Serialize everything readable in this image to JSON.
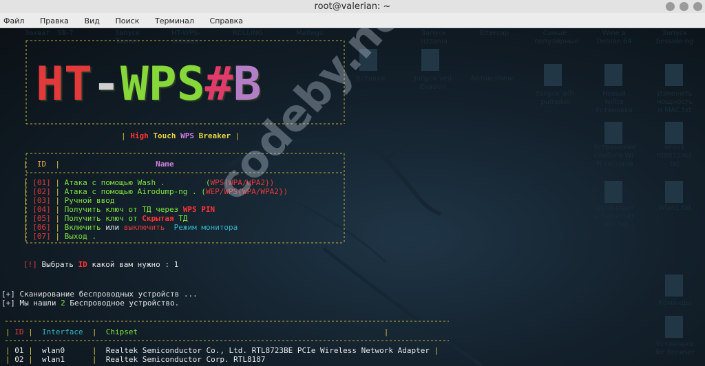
{
  "window": {
    "title": "root@valerian: ~"
  },
  "menu": [
    "Файл",
    "Правка",
    "Вид",
    "Поиск",
    "Терминал",
    "Справка"
  ],
  "banner": {
    "logo_text": "HT-WPS#B",
    "subtitle_pre": "|",
    "subtitle_high": "High",
    "subtitle_touch": "Touch",
    "subtitle_wps": "WPS",
    "subtitle_breaker": "Breaker",
    "subtitle_post": "|"
  },
  "menu_table": {
    "header_id": "ID",
    "header_name": "Name",
    "rows": [
      {
        "id": "[01]",
        "text": "Атака с помощью Wash .         (",
        "tag": "WPS{WPA/WPA2})"
      },
      {
        "id": "[02]",
        "text": "Атака с помощью Airodump-ng . (",
        "tag": "WEP/WPS{WPA/WPA2})"
      },
      {
        "id": "[03]",
        "text": "Ручной ввод"
      },
      {
        "id": "[04]",
        "text": "Получить ключ от ТД через ",
        "tag": "WPS PIN"
      },
      {
        "id": "[05]",
        "text": "Получить ключ от ",
        "tag": "Скрытая",
        "tail": " ТД"
      },
      {
        "id": "[06]",
        "text": "Включить",
        "or": " или ",
        "off": "выключить",
        "mon": "  Режим монитора"
      },
      {
        "id": "[07]",
        "text": "Выход ."
      }
    ]
  },
  "prompt": {
    "bang": "[!]",
    "pre": " Выбрать ",
    "id": "ID",
    "post": " какой вам нужно : 1"
  },
  "status": {
    "scan": "[+] Сканирование беспроводных устройств ...",
    "found_pre": "[+] Мы нашли ",
    "found_num": "2",
    "found_post": " Беспроводное устройство."
  },
  "iface_table": {
    "col_id": "ID",
    "col_iface": "Interface",
    "col_chip": "Chipset",
    "rows": [
      {
        "id": "01",
        "iface": "wlan0",
        "chip": "Realtek Semiconductor Co., Ltd. RTL8723BE PCIe Wireless Network Adapter"
      },
      {
        "id": "02",
        "iface": "wlan1",
        "chip": "Realtek Semiconductor Corp. RTL8187"
      }
    ]
  },
  "watermark": "codeby.net",
  "desktop_labels": [
    "Захват",
    "SB-7",
    "Запуск",
    "HT-WPS-",
    "ROLLING",
    "Maltego",
    "1",
    "Запуск",
    "Ettercap",
    "Самые",
    "Wine в",
    "Запуск",
    "handshake",
    "",
    "Taxmin",
    "Breaker",
    "",
    "",
    "",
    "zizzania",
    "",
    "популярные",
    "Debian 64",
    "besside-ng",
    "Вставки",
    "Запуск Veil-",
    "Автоматиче",
    "Запуск wifi-",
    "Новый",
    "Изменить",
    "Evasion",
    "",
    "pumpkin",
    "wifite",
    "мощность",
    "Установка",
    "и MAC.txt",
    "Устранение",
    "wlan1",
    "слабого Wi-",
    "rtl8812AU.",
    "Fi сигнала",
    "txt",
    "Остановит",
    "Wlan1.txt",
    "ь.Запустит",
    "WiFi.txt",
    "Команды",
    "Установка",
    "Tor Browser"
  ],
  "colors": {
    "wps": "#e43b3b",
    "wpa": "#7fe33e",
    "brace": "#d9c13a"
  }
}
